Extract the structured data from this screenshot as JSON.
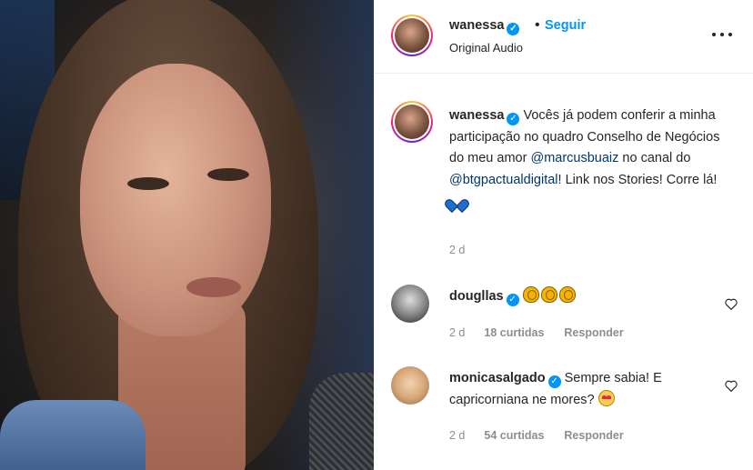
{
  "header": {
    "username": "wanessa",
    "follow_label": "Seguir",
    "dot": "•",
    "audio": "Original Audio"
  },
  "caption": {
    "username": "wanessa",
    "text_1": "Vocês já podem conferir a minha participação no quadro Conselho de Negócios do meu amor",
    "mention_1": "@marcusbuaiz",
    "text_2": "no canal do",
    "mention_2": "@btgpactualdigital",
    "text_3": "! Link nos Stories! Corre lá!",
    "emoji": "blue-heart-icon",
    "time": "2 d"
  },
  "comments": [
    {
      "username": "dougllas",
      "text": "",
      "emoji": "clapping-hands-icon",
      "time": "2 d",
      "likes": "18 curtidas",
      "reply": "Responder"
    },
    {
      "username": "monicasalgado",
      "text": "Sempre sabia! E capricorniana ne mores?",
      "emoji": "star-struck-icon",
      "time": "2 d",
      "likes": "54 curtidas",
      "reply": "Responder"
    }
  ],
  "colors": {
    "accent": "#0095f6",
    "mention": "#00376b",
    "muted": "#8e8e8e",
    "text": "#262626"
  }
}
